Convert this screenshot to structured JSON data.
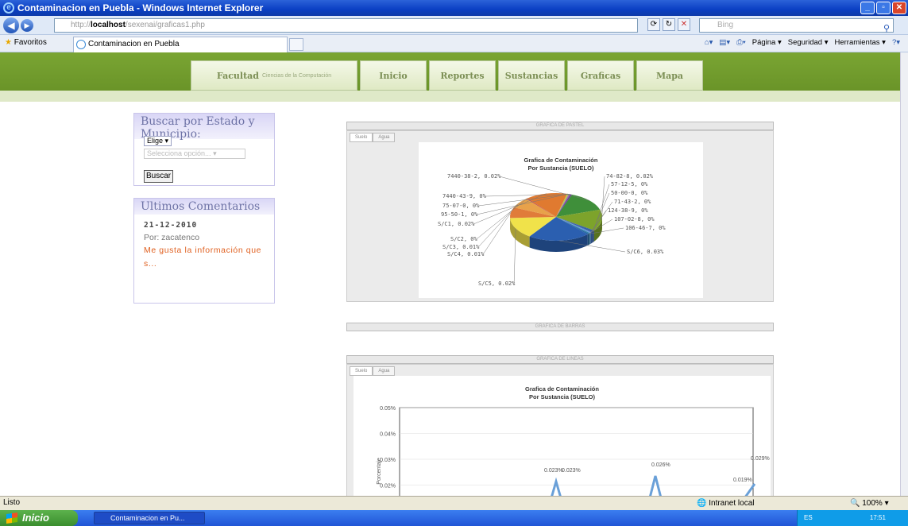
{
  "window": {
    "title": "Contaminacion en Puebla - Windows Internet Explorer",
    "address_prefix": "http://",
    "address_host": "localhost",
    "address_path": "/sexenai/graficas1.php",
    "search_placeholder": "Bing"
  },
  "favorites": {
    "label": "Favoritos",
    "tab_label": "Contaminacion en Puebla"
  },
  "command_bar": {
    "page": "Página",
    "security": "Seguridad",
    "tools": "Herramientas"
  },
  "site": {
    "nav": [
      {
        "label": "Facultad",
        "sub": "Ciencias de la Computación"
      },
      {
        "label": "Inicio"
      },
      {
        "label": "Reportes"
      },
      {
        "label": "Sustancias"
      },
      {
        "label": "Graficas"
      },
      {
        "label": "Mapa"
      }
    ],
    "search_box": {
      "title": "Buscar por Estado y Municipio:",
      "state_select": "Elige",
      "municipio_select": "Selecciona opción...",
      "button": "Buscar"
    },
    "comments_box": {
      "title": "Ultimos Comentarios",
      "date": "21-12-2010",
      "author": "Por: zacatenco",
      "text": "Me gusta la información que s..."
    }
  },
  "charts": {
    "pie_header": "GRAFICA DE PASTEL",
    "tab_suelo": "Suelo",
    "tab_agua": "Agua",
    "pie_title_1": "Grafica de Contaminación",
    "pie_title_2": "Por Sustancia (SUELO)",
    "bar_header": "GRAFICA DE BARRAS",
    "line_header": "GRAFICA DE LINEAS",
    "line_title_1": "Grafica de Contaminación",
    "line_title_2": "Por Sustancia (SUELO)",
    "line_ylabel": "Porcentaje"
  },
  "chart_data": [
    {
      "type": "pie",
      "title": "Grafica de Contaminación Por Sustancia (SUELO)",
      "labels": [
        "7440-38-2, 0.02%",
        "74-82-8, 0.02%",
        "57-12-5, 0%",
        "50-00-0, 0%",
        "71-43-2, 0%",
        "124-38-9, 0%",
        "107-02-8, 0%",
        "106-46-7, 0%",
        "S/C6, 0.03%",
        "S/C5, 0.02%",
        "S/C4, 0.01%",
        "S/C3, 0.01%",
        "S/C2, 0%",
        "S/C1, 0.02%",
        "95-50-1, 0%",
        "75-07-0, 0%",
        "7440-43-9, 0%"
      ],
      "values": [
        0.02,
        0.02,
        0.0,
        0.0,
        0.0,
        0.0,
        0.0,
        0.0,
        0.03,
        0.02,
        0.01,
        0.01,
        0.0,
        0.02,
        0.0,
        0.0,
        0.0
      ],
      "colors": [
        "#3f8f3a",
        "#7da32b",
        "#2f5fa8",
        "#2a4e90",
        "#3a6cc0",
        "#6c9bd8",
        "#2a7fa8",
        "#1e5f9a",
        "#2b5fb0",
        "#f0e24a",
        "#e07c3a",
        "#e8a24a",
        "#c0504d",
        "#e07a30",
        "#b3d34a",
        "#9c6fb0",
        "#6a3d9a"
      ]
    },
    {
      "type": "line",
      "title": "Grafica de Contaminación Por Sustancia (SUELO)",
      "ylabel": "Porcentaje",
      "ylim": [
        0.01,
        0.05
      ],
      "yticks": [
        "0.05%",
        "0.04%",
        "0.03%",
        "0.02%"
      ],
      "point_labels": [
        "0.023%",
        "0.023%",
        "0.026%",
        "0.029%",
        "0.019%"
      ],
      "series_color": "#6aa0d8"
    }
  ],
  "status": {
    "text": "Listo",
    "zone": "Intranet local",
    "zoom": "100%"
  },
  "taskbar": {
    "start": "Inicio",
    "item": "Contaminacion en Pu...",
    "tray": "ES",
    "clock": "17:51"
  }
}
